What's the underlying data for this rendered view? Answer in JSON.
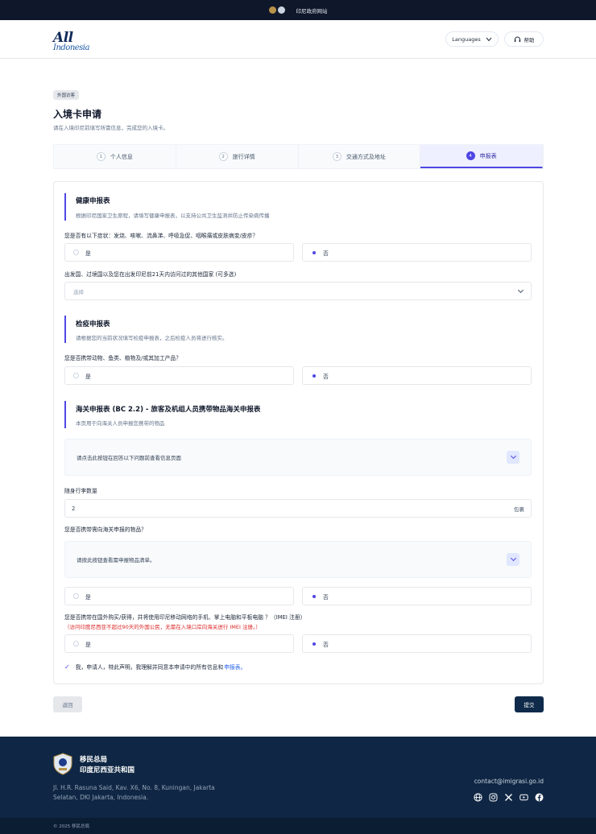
{
  "topbar": {
    "gov_label": "印尼政府网站"
  },
  "header": {
    "logo_main": "All",
    "logo_sub": "Indonesia",
    "languages_label": "Languages",
    "help_label": "帮助"
  },
  "page": {
    "badge": "外国访客",
    "title": "入境卡申请",
    "subtitle": "请在入境印尼前填写所需信息，完成您的入境卡。"
  },
  "steps": [
    {
      "num": "1",
      "label": "个人信息"
    },
    {
      "num": "2",
      "label": "旅行详情"
    },
    {
      "num": "3",
      "label": "交通方式及地址"
    },
    {
      "num": "4",
      "label": "申报表"
    }
  ],
  "health": {
    "title": "健康申报表",
    "desc": "根据印尼国家卫生原程，请填写健康申报表，以支持公共卫生监测并防止传染病传播",
    "q1": "您是否有以下症状：发烧、咳嗽、流鼻涕、呼吸急促、咽喉痛或皮肤病变/皮疹？",
    "q1_yes": "是",
    "q1_no": "否",
    "q2": "出发国、过境国以及您在出发印尼前21天内访问过的其他国家 (可多选)",
    "q2_placeholder": "选择"
  },
  "quarantine": {
    "title": "检疫申报表",
    "desc": "请根据您的当前状况填写检疫申报表，之后检疫人员将进行核实。",
    "q1": "您是否携带动物、鱼类、植物及/或其加工产品？",
    "q1_yes": "是",
    "q1_no": "否"
  },
  "customs": {
    "title": "海关申报表 (BC 2.2) - 旅客及机组人员携带物品海关申报表",
    "desc": "本页用于向海关人员申报您携带的物品",
    "acc1": "请点击此按钮在回答以下问题前查看信息页面",
    "baggage_label": "随身行李数量",
    "baggage_value": "2",
    "baggage_unit": "包裹",
    "q_goods": "您是否携带需向海关申报的物品？",
    "acc2": "请按此按钮查看需申报物品清单。",
    "goods_yes": "是",
    "goods_no": "否",
    "q_imei": "您是否携带在国外购买/获得，并将使用印尼移动网络的手机、掌上电脑和平板电脑 ？（IMEI 注册）",
    "imei_note": "（访问印度尼西亚不超过90天的外国公民，无需在入境口岸向海关进行 IMEI 注册。）",
    "imei_yes": "是",
    "imei_no": "否"
  },
  "consent": {
    "text": "我，申请人，特此声明，我理解并同意本申请中的所有信息和",
    "link": "申报表。"
  },
  "actions": {
    "back": "返回",
    "submit": "提交"
  },
  "footer": {
    "org_line1": "移民总局",
    "org_line2": "印度尼西亚共和国",
    "address": "Jl. H.R. Rasuna Said, Kav. X6, No. 8, Kuningan, Jakarta Selatan, DKI Jakarta, Indonesia.",
    "email": "contact@imigrasi.go.id",
    "social_icons": [
      "globe-icon",
      "instagram-icon",
      "x-icon",
      "youtube-icon",
      "facebook-icon"
    ],
    "copyright": "© 2025 移民总局"
  },
  "colors": {
    "accent": "#4f46e5",
    "navy": "#0f2744",
    "warning": "#dc2626"
  }
}
